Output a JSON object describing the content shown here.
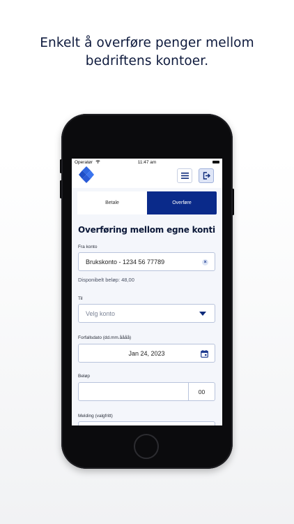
{
  "headline": {
    "line1": "Enkelt å overføre penger mellom",
    "line2": "bedriftens kontoer."
  },
  "statusbar": {
    "carrier": "Operatør",
    "time": "11:47 am"
  },
  "appbar": {
    "logo_icon": "bank-logo",
    "menu_icon": "hamburger-menu-icon",
    "logout_icon": "logout-icon"
  },
  "tabs": [
    {
      "label": "Betale",
      "active": false
    },
    {
      "label": "Overføre",
      "active": true
    }
  ],
  "form": {
    "title": "Overføring mellom egne konti",
    "from_label": "Fra konto",
    "from_value": "Brukskonto - 1234 56 77789",
    "available": "Disponibelt beløp: 48,00",
    "to_label": "Til",
    "to_placeholder": "Velg konto",
    "due_label": "Forfallsdato (dd.mm.åååå)",
    "due_value": "Jan 24, 2023",
    "amount_label": "Beløp",
    "amount_ore": "00",
    "message_label": "Melding (valgfritt)"
  },
  "colors": {
    "brand": "#0a2a8a",
    "accent": "#2f66e0"
  }
}
